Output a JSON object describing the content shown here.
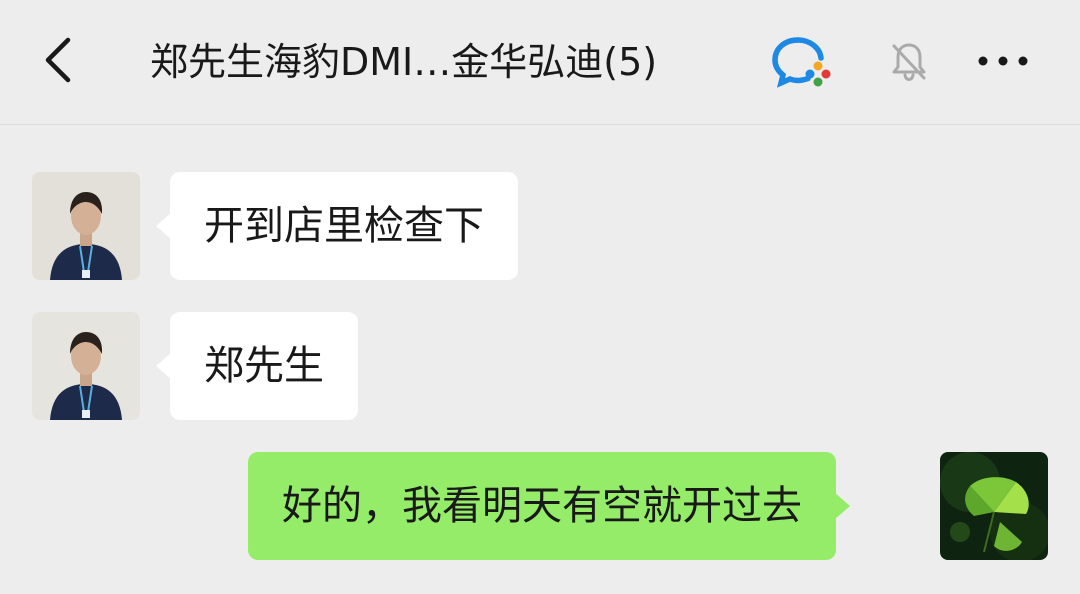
{
  "header": {
    "title": "郑先生海豹DMI…金华弘迪(5)",
    "back_icon": "chevron-left-icon",
    "wecom_icon": "wecom-chat-icon",
    "mute_icon": "bell-muted-icon",
    "more_icon": "more-dots-icon"
  },
  "messages": [
    {
      "side": "in",
      "text": "开到店里检查下"
    },
    {
      "side": "in",
      "text": "郑先生"
    },
    {
      "side": "out",
      "text": "好的，我看明天有空就开过去"
    }
  ],
  "colors": {
    "background": "#ededed",
    "outgoing_bubble": "#95ec69",
    "incoming_bubble": "#ffffff",
    "wecom_blue": "#1e88e5"
  }
}
